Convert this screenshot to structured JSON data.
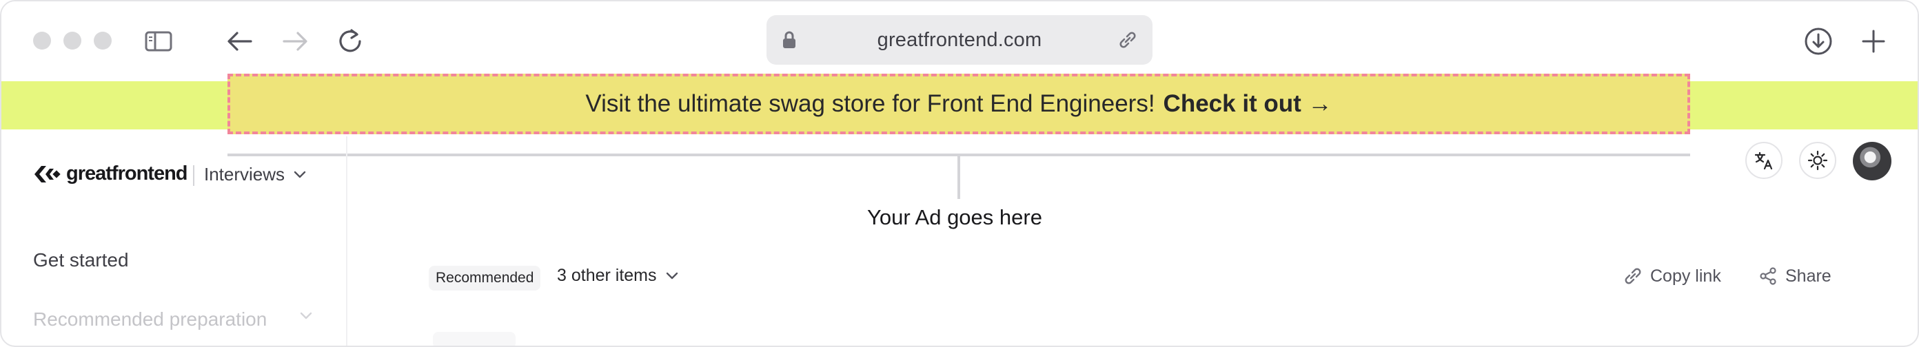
{
  "browser": {
    "url": "greatfrontend.com"
  },
  "banner": {
    "text": "Visit the ultimate swag store for Front End Engineers!",
    "cta": "Check it out →"
  },
  "ad": {
    "label": "Your Ad goes here"
  },
  "sidebar": {
    "logo": "greatfrontend",
    "section": "Interviews",
    "items": [
      {
        "label": "Get started"
      },
      {
        "label": "Recommended preparation"
      }
    ]
  },
  "content": {
    "tag": "Recommended",
    "other_items": "3 other items",
    "copy_link": "Copy link",
    "share": "Share"
  },
  "colors": {
    "banner_bg": "#e6f77e",
    "banner_inner": "#eee47a",
    "banner_border": "#f2869a"
  }
}
